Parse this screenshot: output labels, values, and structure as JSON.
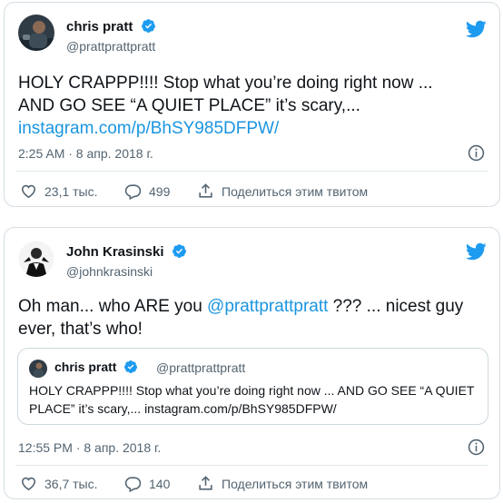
{
  "tweets": [
    {
      "author_name": "chris pratt",
      "handle": "@prattprattpratt",
      "text_line1": "HOLY CRAPPP!!!! Stop what you’re doing right now ...",
      "text_line2": "AND GO SEE “A QUIET PLACE” it’s scary,...",
      "link": "instagram.com/p/BhSY985DFPW/",
      "time": "2:25 AM · 8 апр. 2018 г.",
      "likes": "23,1 тыс.",
      "replies": "499",
      "share_label": "Поделиться этим твитом"
    },
    {
      "author_name": "John Krasinski",
      "handle": "@johnkrasinski",
      "text_line1_pre": "Oh man... who ARE you ",
      "text_line1_mention": "@prattprattpratt",
      "text_line1_post": " ??? ... nicest guy",
      "text_line2": "ever, that’s who!",
      "quote": {
        "author_name": "chris pratt",
        "handle": "@prattprattpratt",
        "text": "HOLY CRAPPP!!!! Stop what you’re doing right now ... AND GO SEE “A QUIET PLACE” it’s scary,... instagram.com/p/BhSY985DFPW/"
      },
      "time": "12:55 PM · 8 апр. 2018 г.",
      "likes": "36,7 тыс.",
      "replies": "140",
      "share_label": "Поделиться этим твитом"
    }
  ],
  "colors": {
    "twitter_blue": "#1d9bf0",
    "link_blue": "#1b95e0",
    "secondary_text": "#536471",
    "border": "#d4dce2"
  }
}
